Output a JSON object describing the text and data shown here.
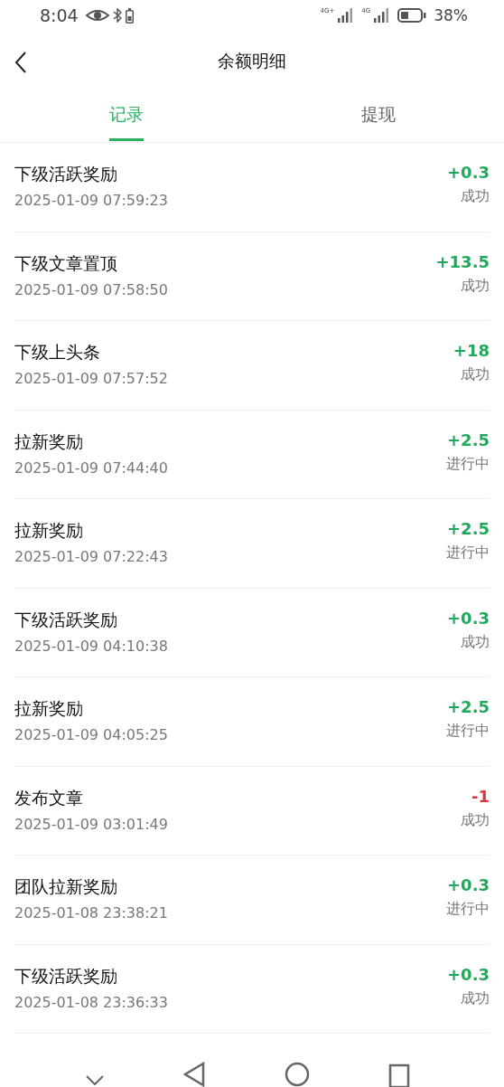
{
  "status_bar": {
    "time": "8:04",
    "sim_labels": [
      "4G+",
      "4G"
    ],
    "battery": "38%"
  },
  "header": {
    "title": "余额明细"
  },
  "tabs": [
    {
      "label": "记录",
      "selected": true
    },
    {
      "label": "提现",
      "selected": false
    }
  ],
  "records": [
    {
      "title": "下级活跃奖励",
      "time": "2025-01-09 07:59:23",
      "amount": "+0.3",
      "kind": "income",
      "status": "成功"
    },
    {
      "title": "下级文章置顶",
      "time": "2025-01-09 07:58:50",
      "amount": "+13.5",
      "kind": "income",
      "status": "成功"
    },
    {
      "title": "下级上头条",
      "time": "2025-01-09 07:57:52",
      "amount": "+18",
      "kind": "income",
      "status": "成功"
    },
    {
      "title": "拉新奖励",
      "time": "2025-01-09 07:44:40",
      "amount": "+2.5",
      "kind": "income",
      "status": "进行中"
    },
    {
      "title": "拉新奖励",
      "time": "2025-01-09 07:22:43",
      "amount": "+2.5",
      "kind": "income",
      "status": "进行中"
    },
    {
      "title": "下级活跃奖励",
      "time": "2025-01-09 04:10:38",
      "amount": "+0.3",
      "kind": "income",
      "status": "成功"
    },
    {
      "title": "拉新奖励",
      "time": "2025-01-09 04:05:25",
      "amount": "+2.5",
      "kind": "income",
      "status": "进行中"
    },
    {
      "title": "发布文章",
      "time": "2025-01-09 03:01:49",
      "amount": "-1",
      "kind": "expense",
      "status": "成功"
    },
    {
      "title": "团队拉新奖励",
      "time": "2025-01-08 23:38:21",
      "amount": "+0.3",
      "kind": "income",
      "status": "进行中"
    },
    {
      "title": "下级活跃奖励",
      "time": "2025-01-08 23:36:33",
      "amount": "+0.3",
      "kind": "income",
      "status": "成功"
    }
  ]
}
